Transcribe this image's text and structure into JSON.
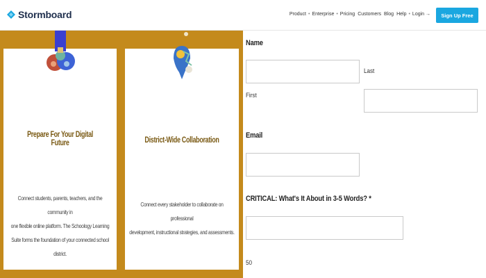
{
  "header": {
    "brand": "Stormboard",
    "nav": [
      "Product",
      "Enterprise",
      "Pricing",
      "Customers",
      "Blog",
      "Help",
      "Login →"
    ],
    "signup_label": "Sign Up Free",
    "colors": {
      "accent": "#1aa7e0",
      "brand_text": "#1f2f4d"
    }
  },
  "cards": [
    {
      "title": "Prepare For Your Digital Future",
      "body": "Connect students, parents, teachers, and the community in\none flexible online platform. The Schoology Learning\nSuite forms the foundation of your connected school district.",
      "icon": "network-people-illustration"
    },
    {
      "title": "District-Wide Collaboration",
      "body": "Connect every stakeholder to collaborate on professional\ndevelopment, instructional strategies, and assessments.",
      "icon": "map-pin-illustration"
    }
  ],
  "form": {
    "name_label": "Name",
    "first_label": "First",
    "last_label": "Last",
    "first_value": "",
    "last_value": "",
    "email_label": "Email",
    "email_value": "",
    "critical_label": "CRITICAL: What's It About in 3-5 Words? *",
    "critical_value": "",
    "char_count": "50"
  },
  "colors": {
    "panel": "#c48a1c",
    "card_title": "#7a5a14"
  }
}
